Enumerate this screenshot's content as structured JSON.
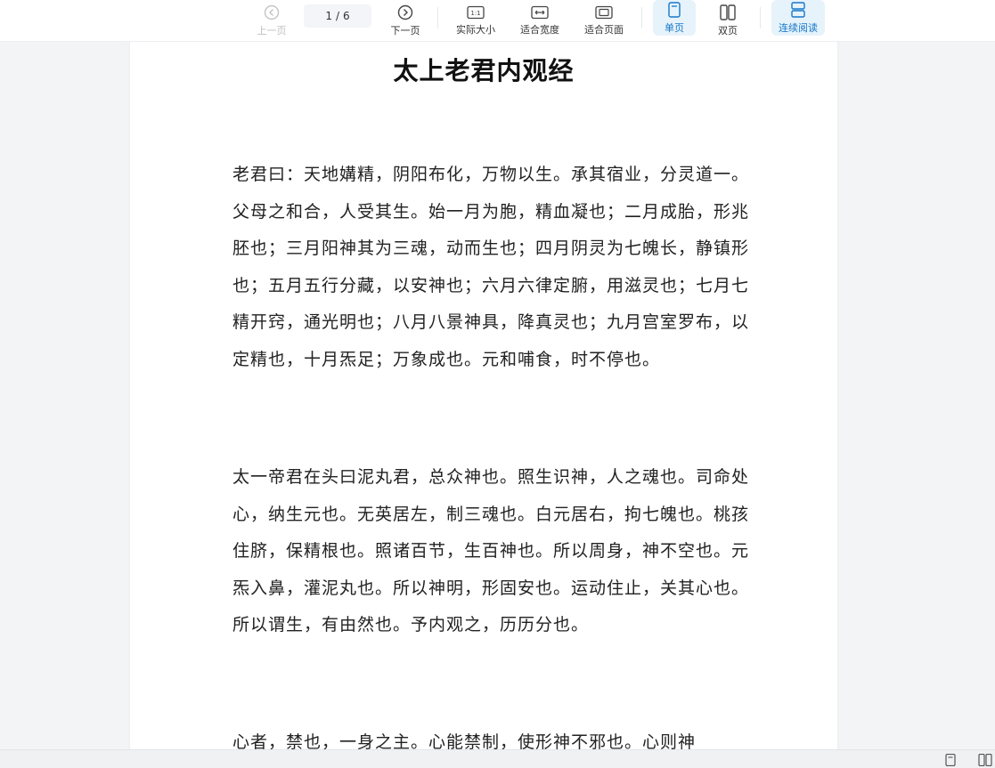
{
  "toolbar": {
    "prev_label": "上一页",
    "next_label": "下一页",
    "current_page": "1",
    "page_separator": "/",
    "total_pages": "6",
    "actual_size_label": "实际大小",
    "fit_width_label": "适合宽度",
    "fit_page_label": "适合页面",
    "single_page_label": "单页",
    "double_page_label": "双页",
    "continuous_label": "连续阅读",
    "actual_size_icon_text": "1:1"
  },
  "document": {
    "title": "太上老君内观经",
    "paragraphs": [
      "老君曰：天地媾精，阴阳布化，万物以生。承其宿业，分灵道一。父母之和合，人受其生。始一月为胞，精血凝也；二月成胎，形兆胚也；三月阳神其为三魂，动而生也；四月阴灵为七魄长，静镇形也；五月五行分藏，以安神也；六月六律定腑，用滋灵也；七月七精开窍，通光明也；八月八景神具，降真灵也；九月宫室罗布，以定精也，十月炁足；万象成也。元和哺食，时不停也。",
      "太一帝君在头曰泥丸君，总众神也。照生识神，人之魂也。司命处心，纳生元也。无英居左，制三魂也。白元居右，拘七魄也。桃孩住脐，保精根也。照诸百节，生百神也。所以周身，神不空也。元炁入鼻，灌泥丸也。所以神明，形固安也。运动住止，关其心也。所以谓生，有由然也。予内观之，历历分也。",
      "心者，禁也，一身之主。心能禁制，使形神不邪也。心则神"
    ]
  },
  "colors": {
    "accent": "#1677c9",
    "active_bg": "#e6f3fb",
    "page_bg": "#ffffff",
    "canvas_bg": "#f3f4f6"
  }
}
